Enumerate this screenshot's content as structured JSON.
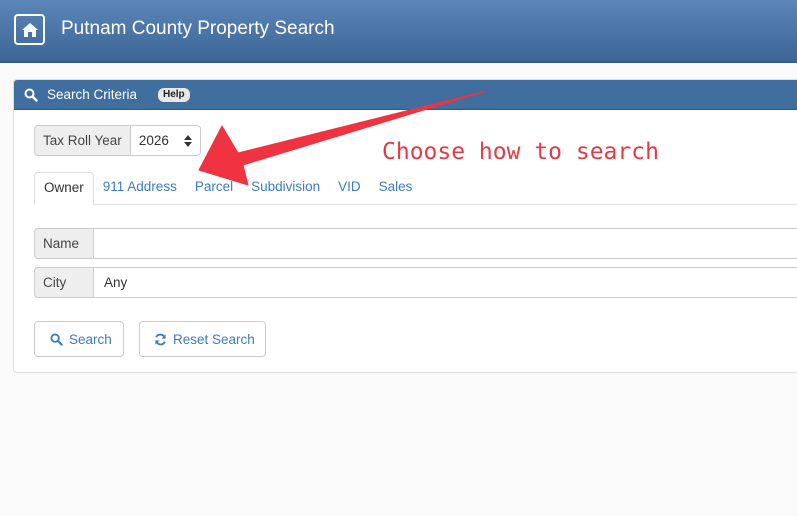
{
  "header": {
    "title": "Putnam County Property Search",
    "home_icon": "home-icon"
  },
  "panel": {
    "title": "Search Criteria",
    "help_label": "Help"
  },
  "tax_roll": {
    "label": "Tax Roll Year",
    "selected": "2026"
  },
  "tabs": [
    {
      "label": "Owner",
      "active": true
    },
    {
      "label": "911 Address"
    },
    {
      "label": "Parcel"
    },
    {
      "label": "Subdivision"
    },
    {
      "label": "VID"
    },
    {
      "label": "Sales"
    }
  ],
  "fields": {
    "name": {
      "label": "Name",
      "value": ""
    },
    "city": {
      "label": "City",
      "value": "Any"
    }
  },
  "buttons": {
    "search": "Search",
    "reset": "Reset Search"
  },
  "annotation": {
    "text": "Choose how to search",
    "color": "#e33b45"
  },
  "colors": {
    "navbar": "#4a75a8",
    "panel_heading": "#3f6e9f",
    "link": "#3b7cc4"
  }
}
